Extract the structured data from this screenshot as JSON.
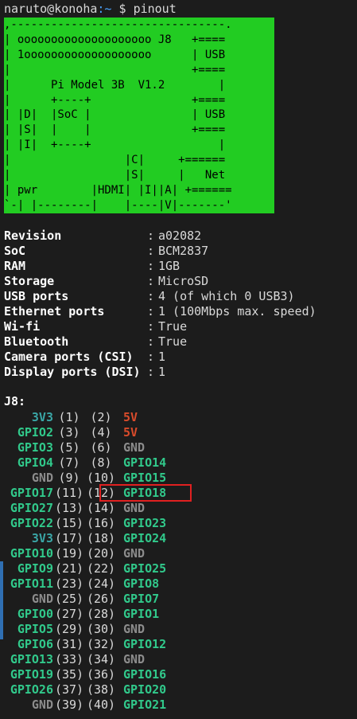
{
  "prompt": {
    "user": "naruto@konoha",
    "path": ":~",
    "symbol": "$",
    "command": "pinout"
  },
  "board": {
    "lines": [
      ",--------------------------------.",
      "| oooooooooooooooooooo J8   +====",
      "| 1ooooooooooooooooooo      | USB",
      "|                           +====",
      "|      Pi Model 3B  V1.2        |",
      "|      +----+               +====",
      "| |D|  |SoC |               | USB",
      "| |S|  |    |               +====",
      "| |I|  +----+                   |",
      "|                 |C|     +======",
      "|                 |S|     |   Net",
      "| pwr        |HDMI| |I||A| +======",
      "`-| |--------|    |----|V|-------'"
    ]
  },
  "info": [
    {
      "key": "Revision",
      "value": "a02082"
    },
    {
      "key": "SoC",
      "value": "BCM2837"
    },
    {
      "key": "RAM",
      "value": "1GB"
    },
    {
      "key": "Storage",
      "value": "MicroSD"
    },
    {
      "key": "USB ports",
      "value": "4 (of which 0 USB3)"
    },
    {
      "key": "Ethernet ports",
      "value": "1 (100Mbps max. speed)"
    },
    {
      "key": "Wi-fi",
      "value": "True"
    },
    {
      "key": "Bluetooth",
      "value": "True"
    },
    {
      "key": "Camera ports (CSI)",
      "value": "1"
    },
    {
      "key": "Display ports (DSI)",
      "value": "1"
    }
  ],
  "header_label": "J8:",
  "pins": [
    {
      "l": "3V3",
      "ln": "(1)",
      "rn": "(2)",
      "r": "5V"
    },
    {
      "l": "GPIO2",
      "ln": "(3)",
      "rn": "(4)",
      "r": "5V"
    },
    {
      "l": "GPIO3",
      "ln": "(5)",
      "rn": "(6)",
      "r": "GND"
    },
    {
      "l": "GPIO4",
      "ln": "(7)",
      "rn": "(8)",
      "r": "GPIO14"
    },
    {
      "l": "GND",
      "ln": "(9)",
      "rn": "(10)",
      "r": "GPIO15"
    },
    {
      "l": "GPIO17",
      "ln": "(11)",
      "rn": "(12)",
      "r": "GPIO18"
    },
    {
      "l": "GPIO27",
      "ln": "(13)",
      "rn": "(14)",
      "r": "GND"
    },
    {
      "l": "GPIO22",
      "ln": "(15)",
      "rn": "(16)",
      "r": "GPIO23"
    },
    {
      "l": "3V3",
      "ln": "(17)",
      "rn": "(18)",
      "r": "GPIO24"
    },
    {
      "l": "GPIO10",
      "ln": "(19)",
      "rn": "(20)",
      "r": "GND"
    },
    {
      "l": "GPIO9",
      "ln": "(21)",
      "rn": "(22)",
      "r": "GPIO25"
    },
    {
      "l": "GPIO11",
      "ln": "(23)",
      "rn": "(24)",
      "r": "GPIO8"
    },
    {
      "l": "GND",
      "ln": "(25)",
      "rn": "(26)",
      "r": "GPIO7"
    },
    {
      "l": "GPIO0",
      "ln": "(27)",
      "rn": "(28)",
      "r": "GPIO1"
    },
    {
      "l": "GPIO5",
      "ln": "(29)",
      "rn": "(30)",
      "r": "GND"
    },
    {
      "l": "GPIO6",
      "ln": "(31)",
      "rn": "(32)",
      "r": "GPIO12"
    },
    {
      "l": "GPIO13",
      "ln": "(33)",
      "rn": "(34)",
      "r": "GND"
    },
    {
      "l": "GPIO19",
      "ln": "(35)",
      "rn": "(36)",
      "r": "GPIO16"
    },
    {
      "l": "GPIO26",
      "ln": "(37)",
      "rn": "(38)",
      "r": "GPIO20"
    },
    {
      "l": "GND",
      "ln": "(39)",
      "rn": "(40)",
      "r": "GPIO21"
    }
  ],
  "colors": {
    "board_green": "#22cc22",
    "gpio": "#31c98b",
    "v3": "#3aa6a6",
    "v5": "#d94b2b",
    "gnd": "#8c8c8c",
    "highlight": "#e02020"
  }
}
